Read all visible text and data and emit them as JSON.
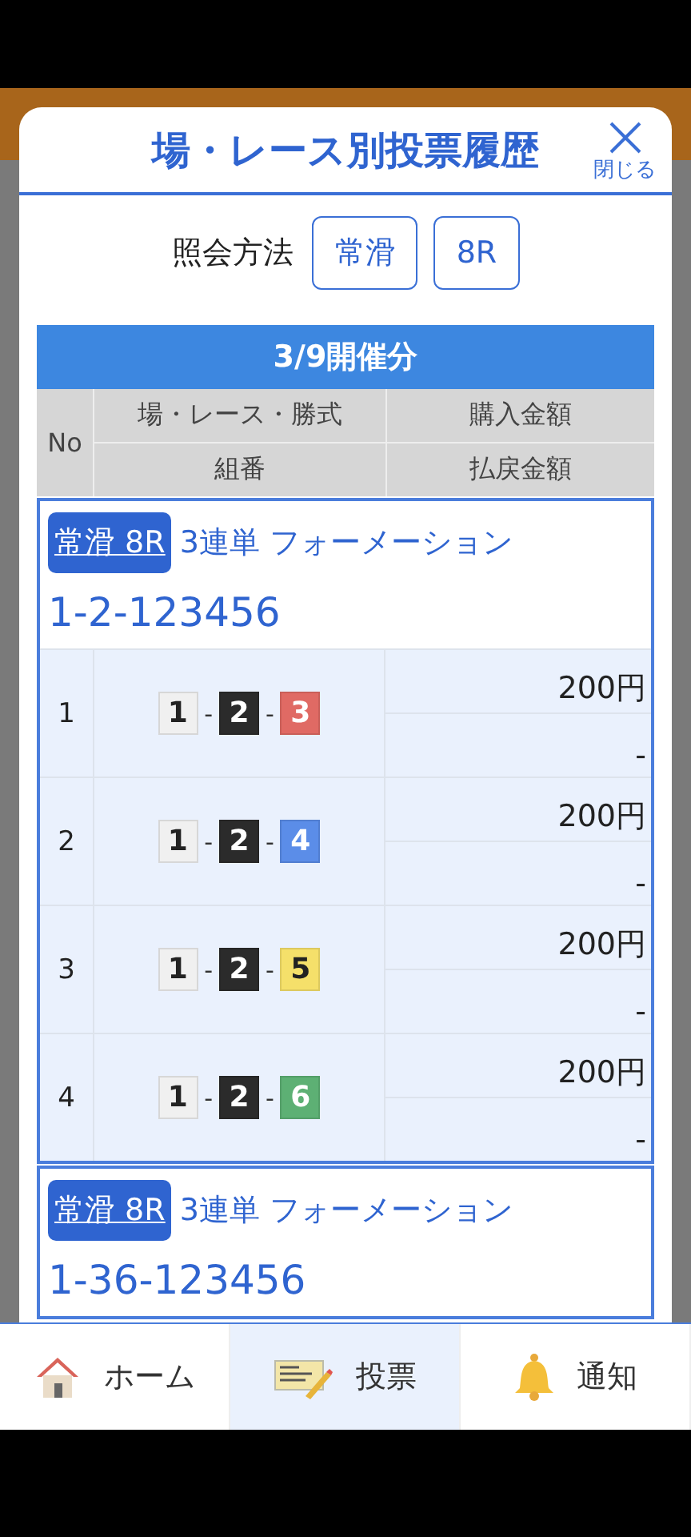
{
  "modal": {
    "title": "場・レース別投票履歴",
    "close_label": "閉じる",
    "filter": {
      "label": "照会方法",
      "buttons": [
        "常滑",
        "8R"
      ]
    },
    "section_title": "3/9開催分",
    "header": {
      "no": "No",
      "row1": [
        "場・レース・勝式",
        "購入金額"
      ],
      "row2": [
        "組番",
        "払戻金額"
      ]
    },
    "groups": [
      {
        "venue_race": "常滑 8R",
        "bet_type": "3連単 フォーメーション",
        "combo_id": "1-2-123456",
        "rows": [
          {
            "no": "1",
            "separator": "-",
            "boats": [
              {
                "number": "1",
                "color": "#f0f0f0"
              },
              {
                "number": "2",
                "color": "#2b2b2b"
              },
              {
                "number": "3",
                "color": "#e06a64"
              }
            ],
            "amount": "200円",
            "payout": "-"
          },
          {
            "no": "2",
            "separator": "-",
            "boats": [
              {
                "number": "1",
                "color": "#f0f0f0"
              },
              {
                "number": "2",
                "color": "#2b2b2b"
              },
              {
                "number": "4",
                "color": "#5b8de8"
              }
            ],
            "amount": "200円",
            "payout": "-"
          },
          {
            "no": "3",
            "separator": "-",
            "boats": [
              {
                "number": "1",
                "color": "#f0f0f0"
              },
              {
                "number": "2",
                "color": "#2b2b2b"
              },
              {
                "number": "5",
                "color": "#f5e06a"
              }
            ],
            "amount": "200円",
            "payout": "-"
          },
          {
            "no": "4",
            "separator": "-",
            "boats": [
              {
                "number": "1",
                "color": "#f0f0f0"
              },
              {
                "number": "2",
                "color": "#2b2b2b"
              },
              {
                "number": "6",
                "color": "#5db074"
              }
            ],
            "amount": "200円",
            "payout": "-"
          }
        ]
      },
      {
        "venue_race": "常滑 8R",
        "bet_type": "3連単 フォーメーション",
        "combo_id": "1-36-123456"
      }
    ]
  },
  "nav": [
    {
      "label": "ホーム",
      "kind": "home",
      "selected": false
    },
    {
      "label": "投票",
      "kind": "vote",
      "selected": true
    },
    {
      "label": "通知",
      "kind": "notice",
      "selected": false
    }
  ]
}
